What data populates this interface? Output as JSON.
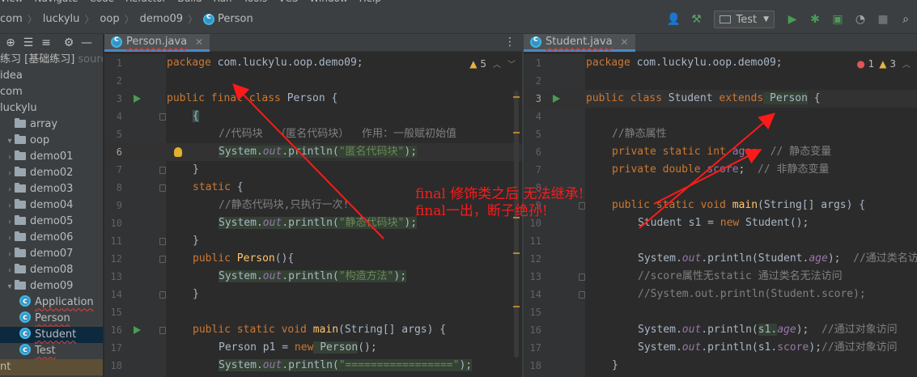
{
  "menubar": [
    "View",
    "Navigate",
    "Code",
    "Refactor",
    "Build",
    "Run",
    "Tools",
    "VCS",
    "Window",
    "Help"
  ],
  "breadcrumbs": [
    "com",
    "luckylu",
    "oop",
    "demo09"
  ],
  "breadcrumb_current": "Person",
  "run_config": "Test",
  "project_tree": [
    {
      "label": "练习 [基础练习]",
      "extra": "source",
      "indent": 0,
      "type": "module"
    },
    {
      "label": "idea",
      "indent": 0,
      "type": "text"
    },
    {
      "label": "com",
      "indent": 0,
      "type": "text"
    },
    {
      "label": "luckylu",
      "indent": 0,
      "type": "text"
    },
    {
      "label": "array",
      "indent": 1,
      "type": "folder",
      "arrow": ""
    },
    {
      "label": "oop",
      "indent": 1,
      "type": "folder",
      "arrow": "▾"
    },
    {
      "label": "demo01",
      "indent": 2,
      "type": "folder",
      "arrow": "›"
    },
    {
      "label": "demo02",
      "indent": 2,
      "type": "folder",
      "arrow": "›"
    },
    {
      "label": "demo03",
      "indent": 2,
      "type": "folder",
      "arrow": "›"
    },
    {
      "label": "demo04",
      "indent": 2,
      "type": "folder",
      "arrow": "›"
    },
    {
      "label": "demo05",
      "indent": 2,
      "type": "folder",
      "arrow": "›"
    },
    {
      "label": "demo06",
      "indent": 2,
      "type": "folder",
      "arrow": "›"
    },
    {
      "label": "demo07",
      "indent": 2,
      "type": "folder",
      "arrow": "›"
    },
    {
      "label": "demo08",
      "indent": 2,
      "type": "folder",
      "arrow": "›"
    },
    {
      "label": "demo09",
      "indent": 2,
      "type": "folder",
      "arrow": "▾"
    },
    {
      "label": "Application",
      "indent": 3,
      "type": "class"
    },
    {
      "label": "Person",
      "indent": 3,
      "type": "class"
    },
    {
      "label": "Student",
      "indent": 3,
      "type": "class",
      "selected": true
    },
    {
      "label": "Test",
      "indent": 3,
      "type": "class"
    },
    {
      "label": "nt",
      "indent": 0,
      "type": "text",
      "highlight": true
    },
    {
      "label": "础练习 [..]",
      "indent": 0,
      "type": "text"
    }
  ],
  "left_tab": "Person.java",
  "right_tab": "Student.java",
  "left_inspections": {
    "warnings": "5"
  },
  "right_inspections": {
    "errors": "1",
    "warnings": "3"
  },
  "left_code": [
    {
      "n": "1"
    },
    {
      "n": "2"
    },
    {
      "n": "3"
    },
    {
      "n": "4"
    },
    {
      "n": "5"
    },
    {
      "n": "6"
    },
    {
      "n": "7"
    },
    {
      "n": "8"
    },
    {
      "n": "9"
    },
    {
      "n": "10"
    },
    {
      "n": "11"
    },
    {
      "n": "12"
    },
    {
      "n": "13"
    },
    {
      "n": "14"
    },
    {
      "n": "15"
    },
    {
      "n": "16"
    },
    {
      "n": "17"
    },
    {
      "n": "18"
    }
  ],
  "left_tokens": {
    "l1_kw": "package",
    "l1_rest": " com.luckylu.oop.demo09;",
    "l3_kw": "public final class",
    "l3_rest": " Person {",
    "l4": "{",
    "l5": "//代码块  （匿名代码块）  作用：一般赋初始值",
    "l6_a": "System.",
    "l6_fld": "out",
    "l6_b": ".println(",
    "l6_str": "\"匿名代码块\"",
    "l6_c": ");",
    "l7": "}",
    "l8_kw": "static",
    "l8_rest": " {",
    "l9": "//静态代码块,只执行一次!",
    "l10_a": "System.",
    "l10_fld": "out",
    "l10_b": ".println(",
    "l10_str": "\"静态代码块\"",
    "l10_c": ");",
    "l11": "}",
    "l12_kw": "public",
    "l12_mth": " Person",
    "l12_rest": "(){",
    "l13_a": "System.",
    "l13_fld": "out",
    "l13_b": ".println(",
    "l13_str": "\"构造方法\"",
    "l13_c": ");",
    "l14": "}",
    "l16_kw": "public static void",
    "l16_mth": " main",
    "l16_rest": "(String[] args) {",
    "l17_a": "Person p1 = ",
    "l17_kw": "new",
    "l17_b": " Person",
    "l17_c": "();",
    "l18_a": "System.",
    "l18_fld": "out",
    "l18_b": ".println(",
    "l18_str": "\"=================\"",
    "l18_c": ");"
  },
  "right_tokens": {
    "l1_kw": "package",
    "l1_rest": " com.luckylu.oop.demo09;",
    "l3_kw": "public class",
    "l3_a": " Student ",
    "l3_kw2": "extends",
    "l3_b": " Person",
    "l3_c": " {",
    "l5": "//静态属性",
    "l6_kw": "private static int",
    "l6_fld": " age",
    "l6_c": ";  ",
    "l6_cmt": "// 静态变量",
    "l7_kw": "private double",
    "l7_fld": " score",
    "l7_c": ";  ",
    "l7_cmt": "// 非静态变量",
    "l9_kw": "public static void",
    "l9_mth": " main",
    "l9_rest": "(String[] args) {",
    "l10_a": "Student s1 = ",
    "l10_kw": "new",
    "l10_b": " Student();",
    "l12_a": "System.",
    "l12_fld": "out",
    "l12_b": ".println(Student.",
    "l12_fld2": "age",
    "l12_c": ");  ",
    "l12_cmt": "//通过类名访问",
    "l13": "//score属性无static 通过类名无法访问",
    "l14": "//System.out.println(Student.score);",
    "l16_a": "System.",
    "l16_fld": "out",
    "l16_b": ".println(",
    "l16_c": "s1.",
    "l16_fld2": "age",
    "l16_d": ");  ",
    "l16_cmt": "//通过对象访问",
    "l17_a": "System.",
    "l17_fld": "out",
    "l17_b": ".println(s1.",
    "l17_fld2": "score",
    "l17_c": ");",
    "l17_cmt": "//通过对象访问",
    "l18": "}"
  },
  "annotation": {
    "line1": "final 修饰类之后 无法继承!",
    "line2": "final一出，断子绝孙!",
    "color": "#ff1a1a"
  },
  "colors": {
    "keyword": "#cc7832",
    "string": "#6a8759",
    "comment": "#808080",
    "field": "#9876aa",
    "method": "#ffc66d",
    "text": "#a9b7c6"
  }
}
